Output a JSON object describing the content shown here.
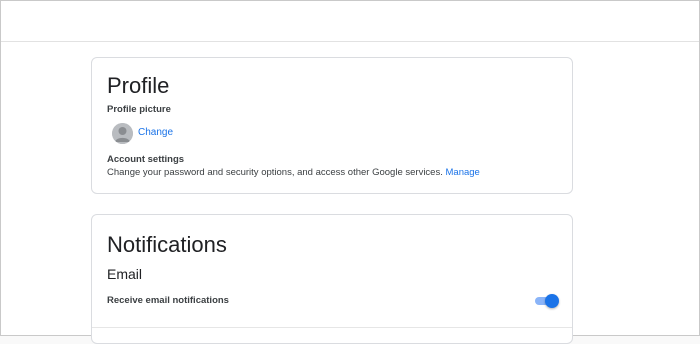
{
  "profile": {
    "title": "Profile",
    "picture_label": "Profile picture",
    "change_label": "Change",
    "account_settings_label": "Account settings",
    "account_settings_description": "Change your password and security options, and access other Google services.",
    "manage_label": "Manage"
  },
  "notifications": {
    "title": "Notifications",
    "email_heading": "Email",
    "receive_label": "Receive email notifications",
    "receive_enabled": true
  },
  "colors": {
    "link": "#1a73e8",
    "toggle_on": "#1a73e8"
  }
}
